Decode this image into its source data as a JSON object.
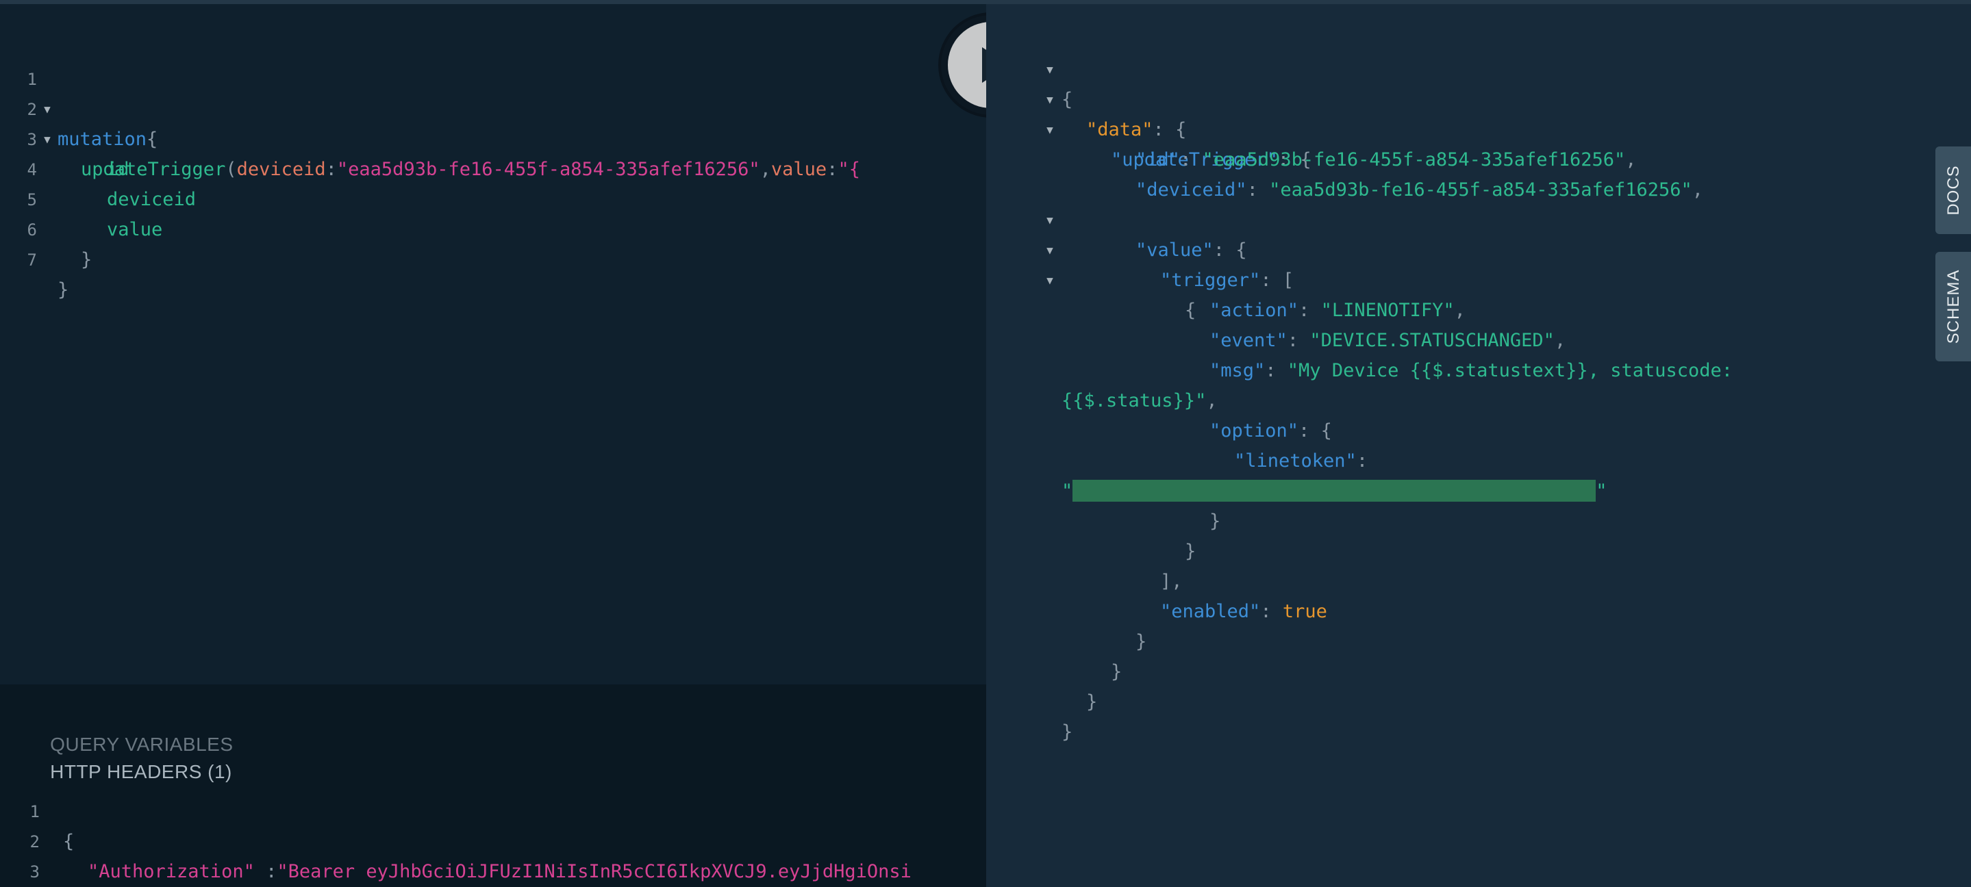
{
  "query_editor": {
    "line_numbers": [
      "1",
      "2",
      "3",
      "4",
      "5",
      "6",
      "7"
    ],
    "line1": {
      "keyword": "mutation",
      "brace": "{"
    },
    "line2": {
      "field": "updateTrigger",
      "open_paren": "(",
      "arg1_name": "deviceid",
      "colon1": ":",
      "arg1_value": "\"eaa5d93b-fe16-455f-a854-335afef16256\"",
      "comma": ",",
      "arg2_name": "value",
      "colon2": ":",
      "arg2_value_start": "\"{"
    },
    "line3": "id",
    "line4": "deviceid",
    "line5": "value",
    "line6": "}",
    "line7": "}"
  },
  "run_button": {
    "icon": "play-icon"
  },
  "variables_pane": {
    "tabs": {
      "query_variables": "QUERY VARIABLES",
      "http_headers": "HTTP HEADERS (1)"
    },
    "line_numbers": [
      "1",
      "2",
      "3"
    ],
    "line1": "{",
    "line2": {
      "key": "\"Authorization\"",
      "sep": " :",
      "value": "\"Bearer eyJhbGciOiJFUzI1NiIsInR5cCI6IkpXVCJ9.eyJjdHgiOnsi"
    },
    "line3": "}"
  },
  "result": {
    "open": "{",
    "data_key": "\"data\"",
    "update_trigger_key": "\"updateTrigger\"",
    "id_key": "\"id\"",
    "id_value": "\"eaa5d93b-fe16-455f-a854-335afef16256\"",
    "deviceid_key": "\"deviceid\"",
    "deviceid_value": "\"eaa5d93b-fe16-455f-a854-335afef16256\"",
    "value_key": "\"value\"",
    "trigger_key": "\"trigger\"",
    "action_key": "\"action\"",
    "action_value": "\"LINENOTIFY\"",
    "event_key": "\"event\"",
    "event_value": "\"DEVICE.STATUSCHANGED\"",
    "msg_key": "\"msg\"",
    "msg_value_part1": "\"My Device {{$.statustext}}, statuscode:",
    "msg_value_part2": "{{$.status}}\"",
    "option_key": "\"option\"",
    "linetoken_key": "\"linetoken\"",
    "quote": "\"",
    "enabled_key": "\"enabled\"",
    "enabled_value": "true",
    "colon_sep": ": ",
    "comma": ",",
    "brace_open": "{",
    "brace_close": "}",
    "bracket_open": "[",
    "bracket_close_comma": "],"
  },
  "side_tabs": {
    "docs": "DOCS",
    "schema": "SCHEMA"
  }
}
